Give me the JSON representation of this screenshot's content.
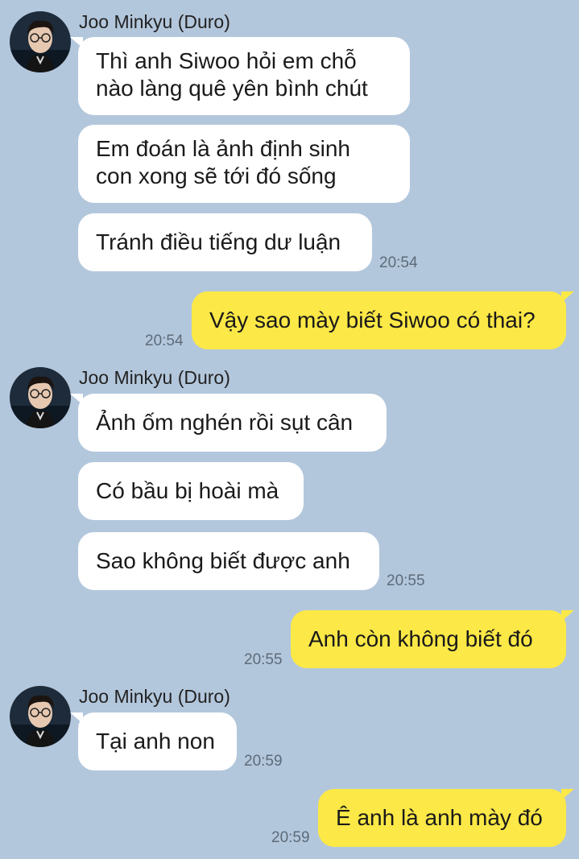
{
  "colors": {
    "background": "#b3c7dc",
    "incoming_bubble": "#ffffff",
    "outgoing_bubble": "#fce846",
    "timestamp": "#5d6b79"
  },
  "messages": {
    "g1": {
      "sender": "Joo Minkyu (Duro)",
      "m1": "Thì anh Siwoo hỏi em chỗ\nnào làng quê yên bình chút",
      "m2": "Em đoán là ảnh định sinh\ncon xong sẽ tới đó sống",
      "m3": "Tránh điều tiếng dư luận",
      "time": "20:54"
    },
    "o1": {
      "text": "Vậy sao mày biết Siwoo có thai?",
      "time": "20:54"
    },
    "g2": {
      "sender": "Joo Minkyu (Duro)",
      "m1": "Ảnh ốm nghén rồi sụt cân",
      "m2": "Có bầu bị hoài mà",
      "m3": "Sao không biết được anh",
      "time": "20:55"
    },
    "o2": {
      "text": "Anh còn không biết đó",
      "time": "20:55"
    },
    "g3": {
      "sender": "Joo Minkyu (Duro)",
      "m1": "Tại anh non",
      "time": "20:59"
    },
    "o3": {
      "text": "Ê anh là anh mày đó",
      "time": "20:59"
    }
  }
}
